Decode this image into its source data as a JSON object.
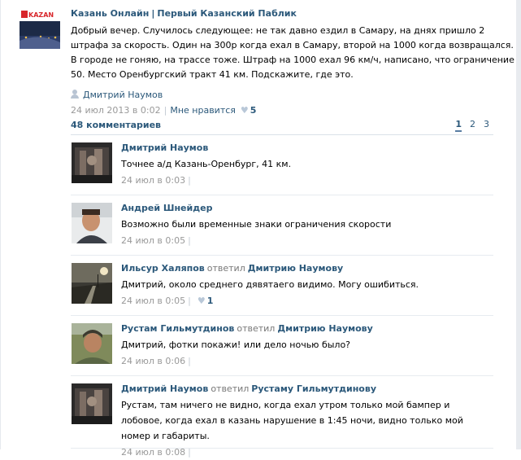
{
  "post": {
    "group_name": "Казань Онлайн",
    "group_separator": "|",
    "group_subtitle": "Первый Казанский Паблик",
    "logo_text": "KAZAN",
    "text": "Добрый вечер. Случилось следующее: не так давно ездил в Самару, на днях пришло 2 штрафа за скорость. Один на 300р когда ехал в Самару, второй на 1000 когда возвращался. В городе не гоняю, на трассе тоже. Штраф на 1000 ехал 96 км/ч, написано, что ограничение 50. Место Оренбургский тракт 41 км. Подскажите, где это.",
    "signer": "Дмитрий Наумов",
    "date": "24 июл 2013 в 0:02",
    "like_label": "Мне нравится",
    "like_count": "5"
  },
  "comments_header": {
    "count_label": "48 комментариев",
    "pages": [
      "1",
      "2",
      "3"
    ],
    "current_page": "1"
  },
  "comments": [
    {
      "author": "Дмитрий Наумов",
      "replied": "",
      "reply_to": "",
      "text": "Точнее а/д Казань-Оренбург, 41 км.",
      "date": "24 июл в 0:03",
      "likes": ""
    },
    {
      "author": "Андрей Шнейдер",
      "replied": "",
      "reply_to": "",
      "text": "Возможно были временные знаки ограничения скорости",
      "date": "24 июл в 0:05",
      "likes": ""
    },
    {
      "author": "Ильсур Халяпов",
      "replied": "ответил",
      "reply_to": "Дмитрию Наумову",
      "text": "Дмитрий, около среднего дявятаего видимо. Могу ошибиться.",
      "date": "24 июл в 0:05",
      "likes": "1"
    },
    {
      "author": "Рустам Гильмутдинов",
      "replied": "ответил",
      "reply_to": "Дмитрию Наумову",
      "text": "Дмитрий, фотки покажи! или дело ночью было?",
      "date": "24 июл в 0:06",
      "likes": ""
    },
    {
      "author": "Дмитрий Наумов",
      "replied": "ответил",
      "reply_to": "Рустаму Гильмутдинову",
      "text": "Рустам, там ничего не видно, когда ехал утром только мой бампер и лобовое, когда ехал в казань нарушение в 1:45 ночи, видно только мой номер и габариты.",
      "date": "24 июл в 0:08",
      "likes": ""
    }
  ],
  "colors": {
    "link": "#2b587a",
    "meta": "#999999",
    "heart": "#b9c8d8",
    "logo_red": "#d8262b"
  },
  "icons": {
    "signer": "person-icon",
    "like": "heart-icon"
  }
}
